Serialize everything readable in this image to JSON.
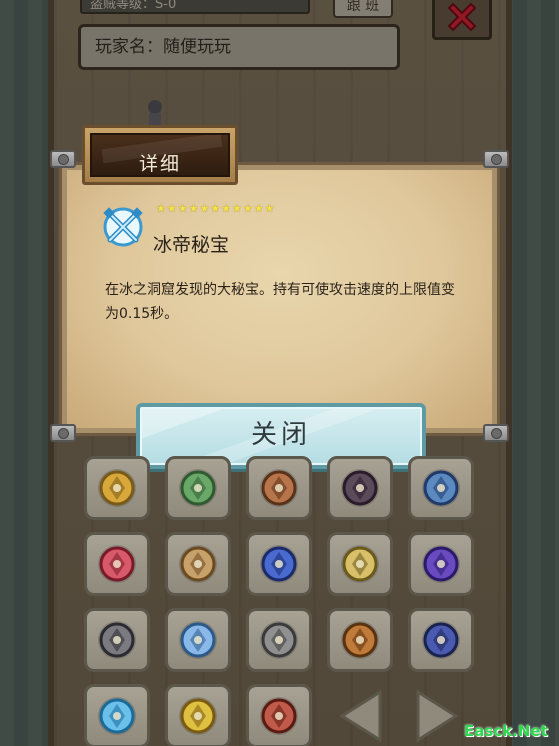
{
  "header": {
    "rank_label": "盗贼等级：S-0",
    "follow_button": "跟 班",
    "player_name": "玩家名：随便玩玩"
  },
  "dialog": {
    "title": "详细",
    "stars": "★★★★★★★★★★★",
    "star_count": 11,
    "item_name": "冰帝秘宝",
    "item_description": "在冰之洞窟发现的大秘宝。持有可使攻击速度的上限值变为0.15秒。",
    "close_button": "关闭"
  },
  "colors": {
    "parchment": "#dfc79b",
    "ice_button": "#c6e6ea",
    "star": "#f4e34a",
    "close_x": "#e0263b"
  },
  "grid": {
    "rows": [
      [
        "gold-medal-icon",
        "green-bird-shield-icon",
        "wooden-shield-icon",
        "dark-spider-icon",
        "blue-castle-icon"
      ],
      [
        "red-book-icon",
        "beast-head-icon",
        "magic-book-icon",
        "golden-girl-icon",
        "purple-helmet-icon"
      ],
      [
        "grey-wolf-icon",
        "ice-shield-icon",
        "iron-shield-icon",
        "wood-logs-icon",
        "blue-compass-icon"
      ],
      [
        "ice-swords-icon",
        "golden-mask-icon",
        "red-demon-icon"
      ]
    ]
  },
  "watermark": "Easck.Net"
}
